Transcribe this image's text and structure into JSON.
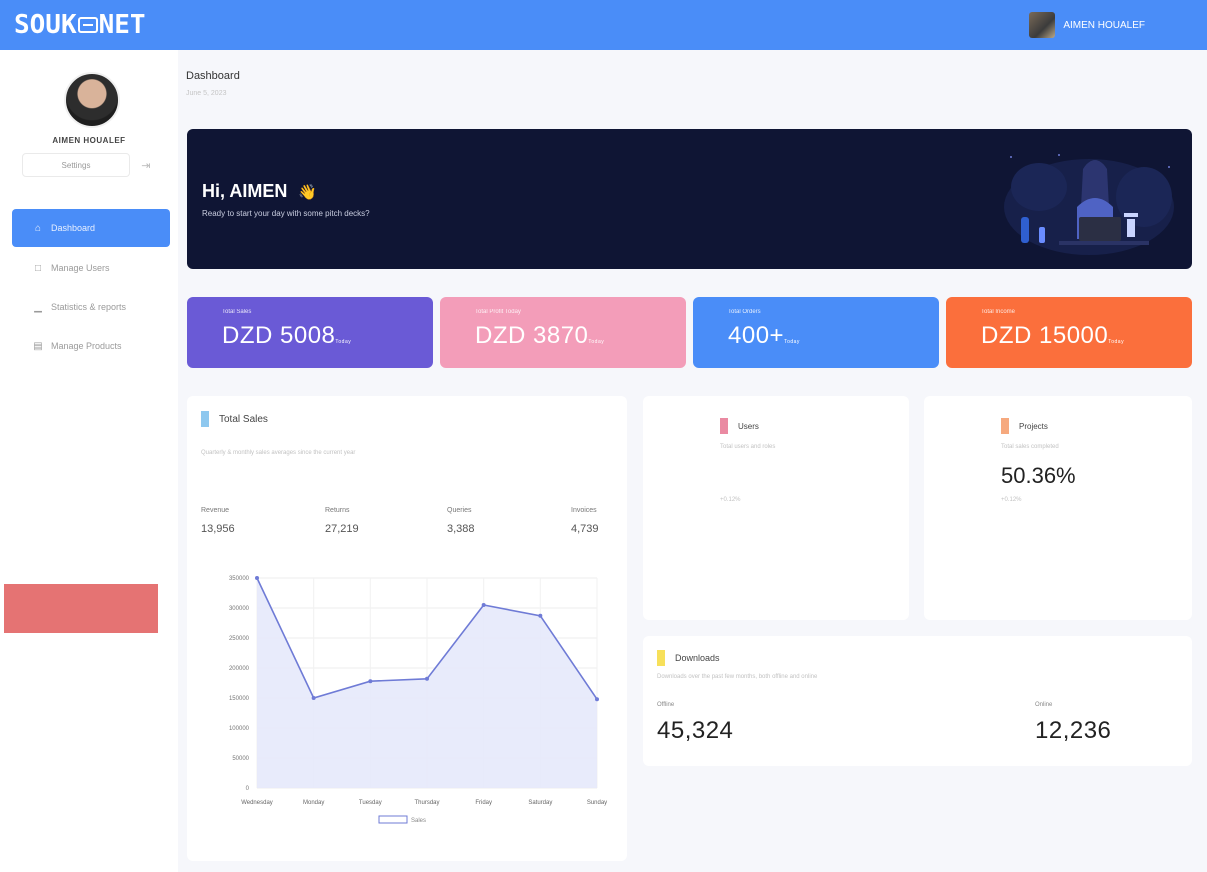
{
  "header": {
    "logo": {
      "left": "SOUK",
      "right": "NET"
    },
    "user_name": "AIMEN HOUALEF"
  },
  "sidebar": {
    "profile_name": "AIMEN HOUALEF",
    "settings_label": "Settings",
    "items": [
      {
        "label": "Dashboard",
        "icon": "home-icon",
        "active": true
      },
      {
        "label": "Manage Users",
        "icon": "users-icon",
        "active": false
      },
      {
        "label": "Statistics & reports",
        "icon": "chart-icon",
        "active": false
      },
      {
        "label": "Manage Products",
        "icon": "box-icon",
        "active": false
      }
    ]
  },
  "page": {
    "title": "Dashboard",
    "date": "June 5, 2023"
  },
  "banner": {
    "greeting": "Hi, AIMEN",
    "wave": "👋",
    "subtitle": "Ready to start your day with some pitch decks?"
  },
  "stats": [
    {
      "label": "Total Sales",
      "value": "DZD 5008",
      "unit": "Today",
      "color": "#6a5ad6"
    },
    {
      "label": "Total Profit Today",
      "value": "DZD 3870",
      "unit": "Today",
      "color": "#f39db9"
    },
    {
      "label": "Total Orders",
      "value": "400+",
      "unit": "Today",
      "color": "#4a8df8"
    },
    {
      "label": "Total Income",
      "value": "DZD 15000",
      "unit": "Today",
      "color": "#fb6f3c"
    }
  ],
  "total_sales": {
    "title": "Total Sales",
    "subtitle": "Quarterly & monthly sales averages since the current year",
    "marker_color": "#8ec8ef",
    "metrics": [
      {
        "label": "Revenue",
        "value": "13,956"
      },
      {
        "label": "Returns",
        "value": "27,219"
      },
      {
        "label": "Queries",
        "value": "3,388"
      },
      {
        "label": "Invoices",
        "value": "4,739"
      }
    ]
  },
  "users_card": {
    "title": "Users",
    "subtitle": "Total users and roles",
    "footnote": "+0.12%",
    "marker_color": "#ea8aa2"
  },
  "projects_card": {
    "title": "Projects",
    "subtitle": "Total sales completed",
    "value": "50.36%",
    "footnote": "+0.12%",
    "marker_color": "#f6a97e"
  },
  "downloads_card": {
    "title": "Downloads",
    "subtitle": "Downloads over the past few months, both offline and online",
    "marker_color": "#f7e05a",
    "offline_label": "Offline",
    "offline_value": "45,324",
    "online_label": "Online",
    "online_value": "12,236"
  },
  "chart_data": {
    "type": "area",
    "categories": [
      "Wednesday",
      "Monday",
      "Tuesday",
      "Thursday",
      "Friday",
      "Saturday",
      "Sunday"
    ],
    "series": [
      {
        "name": "Sales",
        "values": [
          350000,
          150000,
          178000,
          182000,
          305000,
          287000,
          148000
        ]
      }
    ],
    "ylim": [
      0,
      350000
    ],
    "yticks": [
      0,
      50000,
      100000,
      150000,
      200000,
      250000,
      300000,
      350000
    ],
    "ytick_labels": [
      "0",
      "50000",
      "100000",
      "150000",
      "200000",
      "250000",
      "300000",
      "350000"
    ],
    "grid": true,
    "legend": "bottom",
    "line_color": "#6f7bd6",
    "fill_color": "#e6e9fb"
  }
}
